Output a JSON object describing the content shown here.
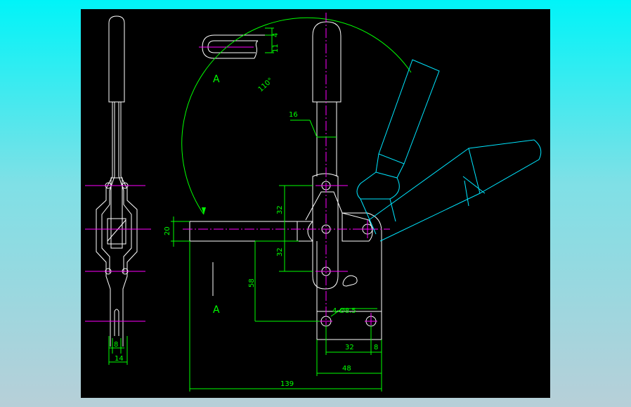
{
  "colors": {
    "background_gradient_top": "#00f4f8",
    "background_gradient_bottom": "#b7cfd8",
    "canvas": "#000000",
    "outline": "#ffffff",
    "alt_position": "#00e6ff",
    "dimension": "#00ff00",
    "centerline": "#ff00ff"
  },
  "dimensions": {
    "slot_top": "4",
    "slot_width": "11",
    "rod_width": "16",
    "angle": "110°",
    "bar_height": "20",
    "pitch_upper": "32",
    "pitch_lower": "32",
    "height_58": "58",
    "holes": "4-Ø8.5",
    "base_32": "32",
    "base_8": "8",
    "base_48": "48",
    "overall_139": "139",
    "side_8": "8",
    "side_14": "14"
  },
  "labels": {
    "section_a_top": "A",
    "section_a_bottom": "A"
  }
}
